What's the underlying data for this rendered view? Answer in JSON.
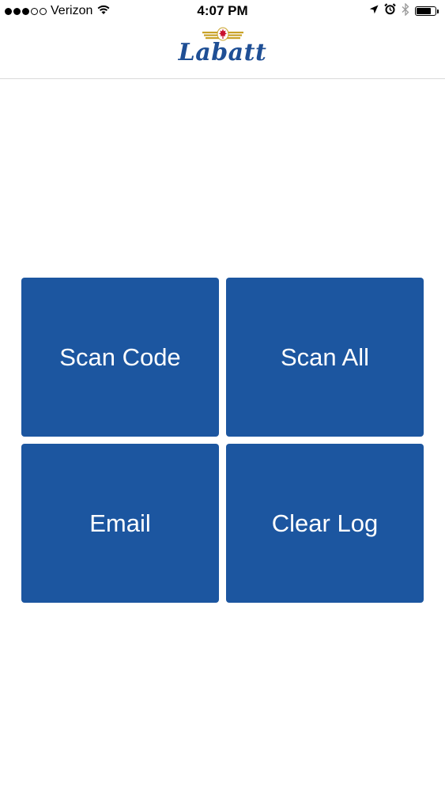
{
  "status_bar": {
    "carrier": "Verizon",
    "signal_bars_filled": 3,
    "signal_bars_total": 5,
    "time": "4:07 PM",
    "icons": [
      "wifi-icon",
      "location-arrow-icon",
      "alarm-icon",
      "bluetooth-icon",
      "battery-icon"
    ],
    "battery_level": 0.8
  },
  "header": {
    "logo_text": "Labatt",
    "logo_colors": {
      "brand_blue": "#1f4f95",
      "gold": "#c9a227",
      "red": "#c8102e"
    }
  },
  "actions": {
    "scan_code": "Scan Code",
    "scan_all": "Scan All",
    "email": "Email",
    "clear_log": "Clear Log"
  },
  "theme": {
    "tile_color": "#1c56a0",
    "tile_text_color": "#ffffff",
    "background": "#ffffff"
  }
}
